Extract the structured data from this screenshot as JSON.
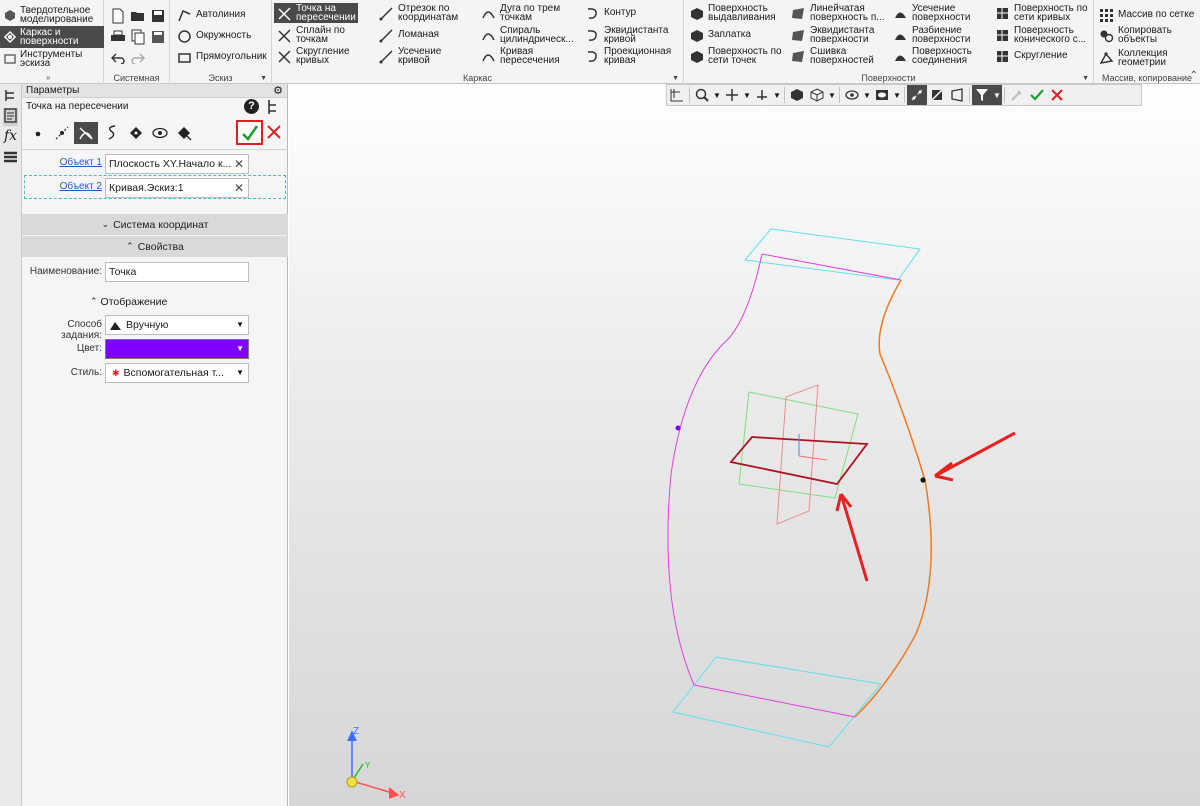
{
  "modes": [
    "Твердотельное\nмоделирование",
    "Каркас и\nповерхности",
    "Инструменты\nэскиза"
  ],
  "sections": {
    "system": "Системная",
    "sketch": "Эскиз",
    "frame": "Каркас",
    "surfaces": "Поверхности",
    "array": "Массив, копирование"
  },
  "sketch_items": [
    "Автолиния",
    "Окружность",
    "Прямоугольник"
  ],
  "frame_items": [
    "Точка на\nпересечении",
    "Отрезок по\nкоординатам",
    "Дуга по трем\nточкам",
    "Контур",
    "Сплайн по\nточкам",
    "Ломаная",
    "Спираль\nцилиндрическ...",
    "Эквидистанта\nкривой",
    "Скругление\nкривых",
    "Усечение\nкривой",
    "Кривая\nпересечения",
    "Проекционная\nкривая"
  ],
  "surface_items": [
    "Поверхность\nвыдавливания",
    "Линейчатая\nповерхность п...",
    "Усечение\nповерхности",
    "Поверхность по\nсети кривых",
    "Заплатка",
    "Эквидистанта\nповерхности",
    "Разбиение\nповерхности",
    "Поверхность\nконического с...",
    "Поверхность по\nсети точек",
    "Сшивка\nповерхностей",
    "Поверхность\nсоединения",
    "Скругление"
  ],
  "array_items": [
    "Массив по сетке",
    "Копировать\nобъекты",
    "Коллекция\nгеометрии"
  ],
  "panel": {
    "title": "Параметры",
    "op_name": "Точка на пересечении",
    "object1_label": "Объект 1",
    "object1_value": "Плоскость XY.Начало к...",
    "object2_label": "Объект 2",
    "object2_value": "Кривая.Эскиз:1",
    "coord_section": "Система координат",
    "props_section": "Свойства",
    "name_label": "Наименование:",
    "name_value": "Точка",
    "display_section": "Отображение",
    "method_label": "Способ задания:",
    "method_value": "Вручную",
    "color_label": "Цвет:",
    "color_value": "#8000ff",
    "style_label": "Стиль:",
    "style_value": "Вспомогательная т..."
  },
  "axes": {
    "x": "X",
    "y": "Y",
    "z": "Z"
  },
  "colors": {
    "accent_green": "#1e9e2e",
    "cancel_red": "#e02020",
    "highlight_box": "#e02020",
    "curve_magenta": "#e040e0",
    "curve_orange": "#f07820",
    "plane_cyan": "#60e0f0",
    "plane_red": "#b01020",
    "annotation_red": "#e82020"
  }
}
